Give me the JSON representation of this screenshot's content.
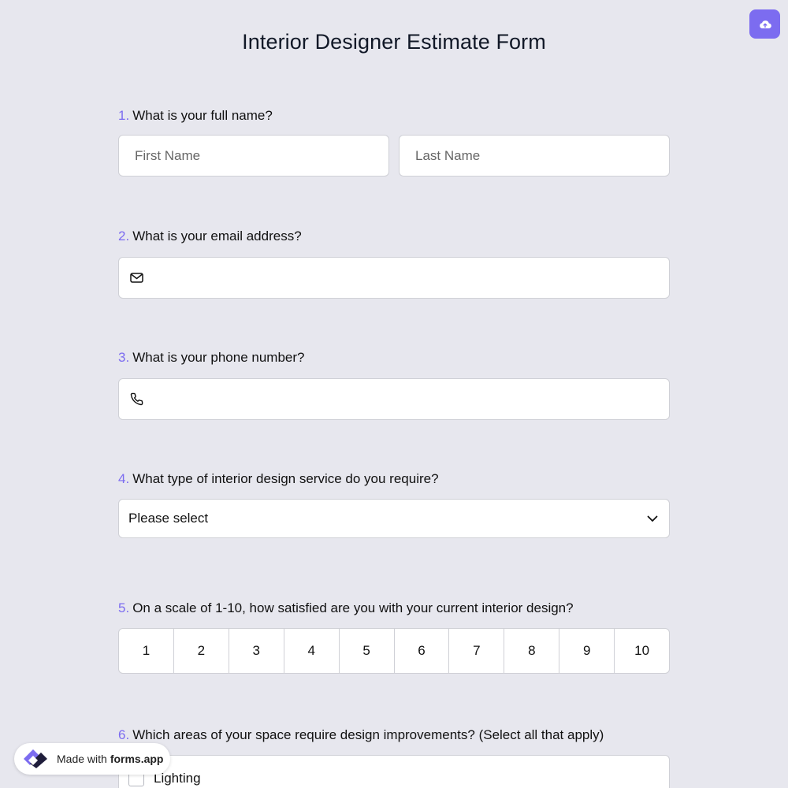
{
  "form": {
    "title": "Interior Designer Estimate Form"
  },
  "questions": {
    "q1": {
      "number": "1.",
      "label": "What is your full name?",
      "first_placeholder": "First Name",
      "last_placeholder": "Last Name"
    },
    "q2": {
      "number": "2.",
      "label": "What is your email address?",
      "icon": "mail-icon"
    },
    "q3": {
      "number": "3.",
      "label": "What is your phone number?",
      "icon": "phone-icon"
    },
    "q4": {
      "number": "4.",
      "label": "What type of interior design service do you require?",
      "select_value": "Please select"
    },
    "q5": {
      "number": "5.",
      "label": "On a scale of 1-10, how satisfied are you with your current interior design?",
      "options": [
        "1",
        "2",
        "3",
        "4",
        "5",
        "6",
        "7",
        "8",
        "9",
        "10"
      ]
    },
    "q6": {
      "number": "6.",
      "label": "Which areas of your space require design improvements? (Select all that apply)",
      "first_option": "Lighting"
    }
  },
  "badge": {
    "prefix": "Made with",
    "brand": "forms.app"
  },
  "colors": {
    "accent": "#7c6cf0",
    "background": "#e7e7ee"
  }
}
